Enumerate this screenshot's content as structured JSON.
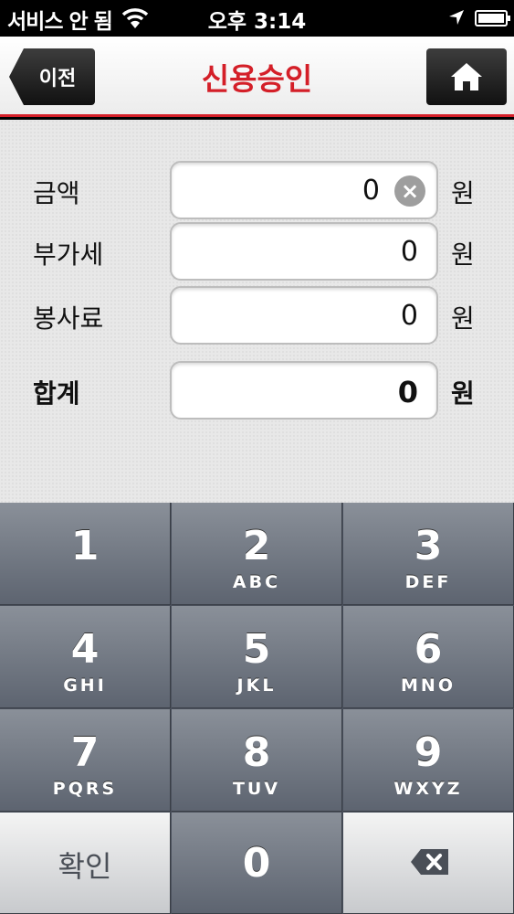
{
  "status_bar": {
    "carrier": "서비스 안 됨",
    "time": "오후 3:14"
  },
  "header": {
    "back_label": "이전",
    "title": "신용승인",
    "home_icon": "home-icon"
  },
  "form": {
    "rows": [
      {
        "label": "금액",
        "value": "0",
        "unit": "원"
      },
      {
        "label": "부가세",
        "value": "0",
        "unit": "원"
      },
      {
        "label": "봉사료",
        "value": "0",
        "unit": "원"
      },
      {
        "label": "합계",
        "value": "0",
        "unit": "원"
      }
    ],
    "clear_icon": "clear-icon"
  },
  "keypad": {
    "keys": [
      {
        "digit": "1",
        "letters": ""
      },
      {
        "digit": "2",
        "letters": "ABC"
      },
      {
        "digit": "3",
        "letters": "DEF"
      },
      {
        "digit": "4",
        "letters": "GHI"
      },
      {
        "digit": "5",
        "letters": "JKL"
      },
      {
        "digit": "6",
        "letters": "MNO"
      },
      {
        "digit": "7",
        "letters": "PQRS"
      },
      {
        "digit": "8",
        "letters": "TUV"
      },
      {
        "digit": "9",
        "letters": "WXYZ"
      },
      {
        "digit": "0",
        "letters": ""
      }
    ],
    "confirm_label": "확인",
    "delete_icon": "delete-icon"
  },
  "colors": {
    "accent_red": "#d41f28",
    "keypad_dark": "#5d6470"
  }
}
